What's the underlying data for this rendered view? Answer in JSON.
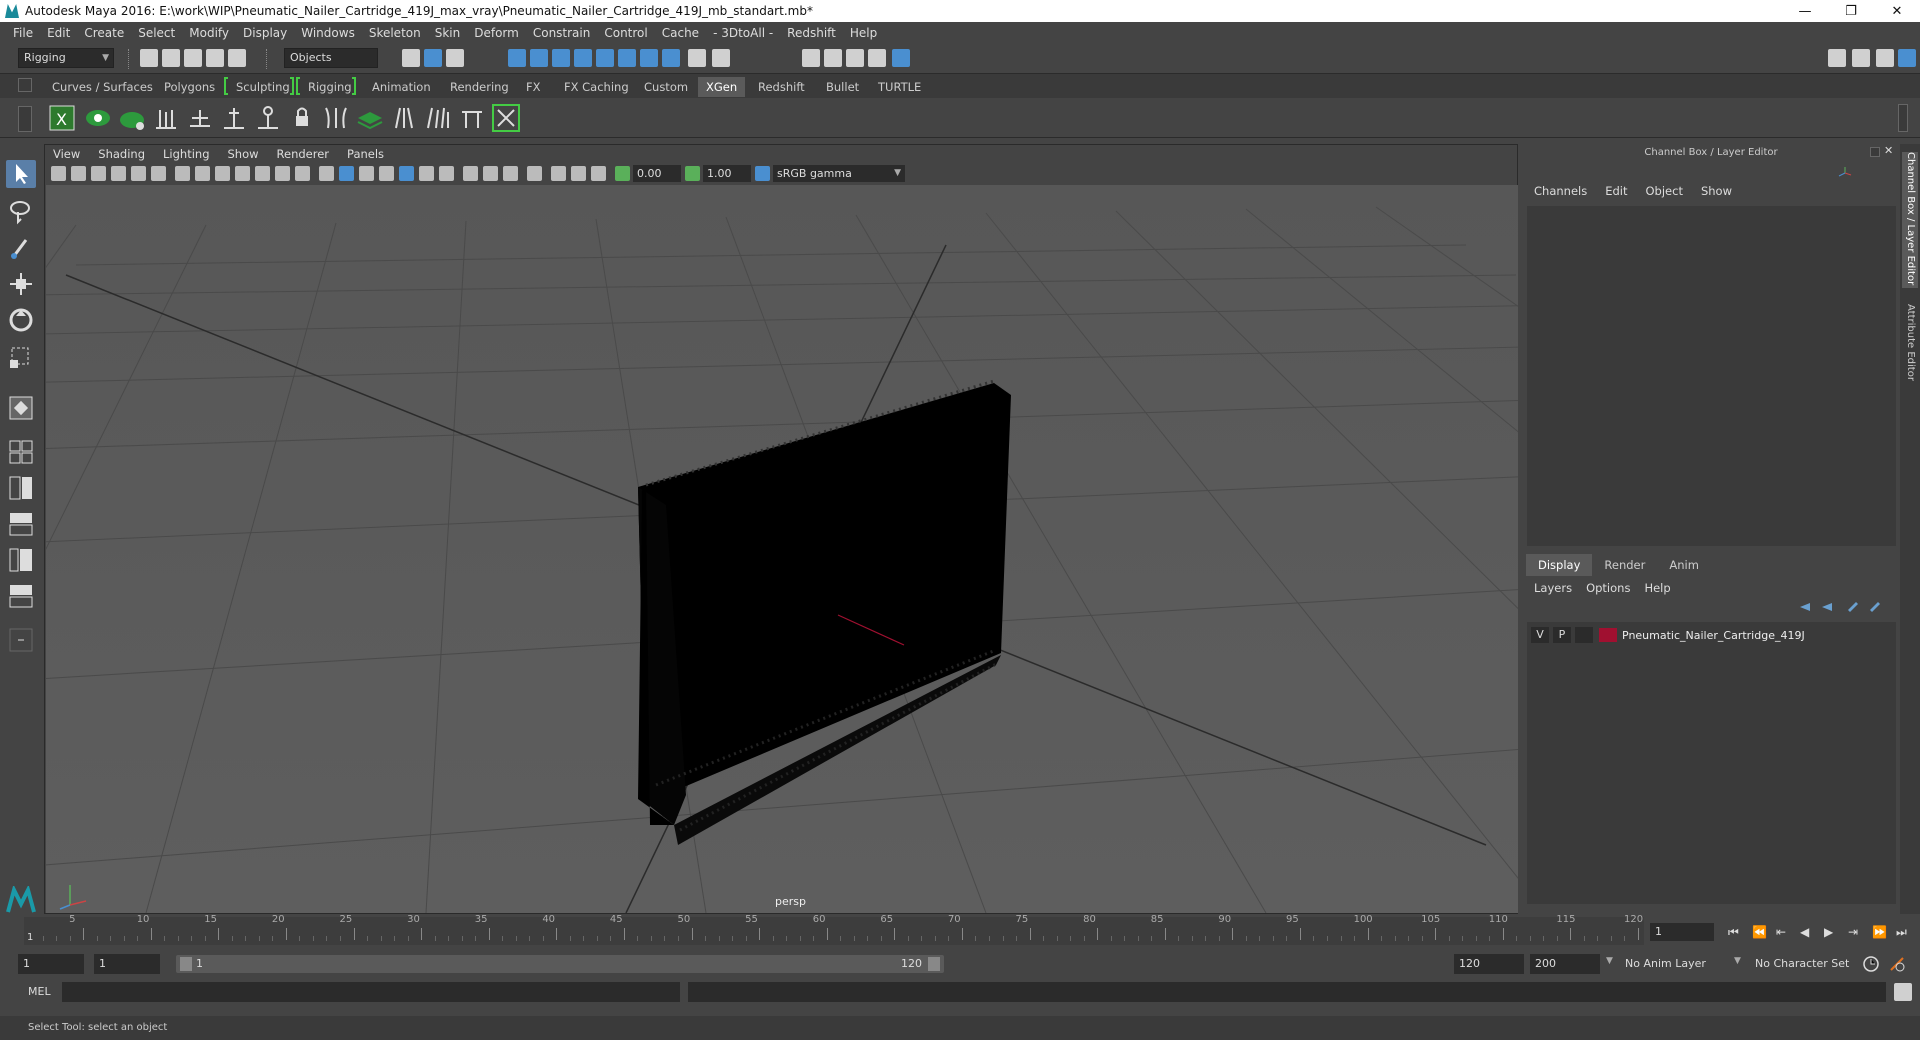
{
  "window": {
    "title": "Autodesk Maya 2016: E:\\work\\WIP\\Pneumatic_Nailer_Cartridge_419J_max_vray\\Pneumatic_Nailer_Cartridge_419J_mb_standart.mb*",
    "min": "—",
    "max": "❐",
    "close": "✕"
  },
  "menubar": [
    "File",
    "Edit",
    "Create",
    "Select",
    "Modify",
    "Display",
    "Windows",
    "Skeleton",
    "Skin",
    "Deform",
    "Constrain",
    "Control",
    "Cache",
    "- 3DtoAll -",
    "Redshift",
    "Help"
  ],
  "status": {
    "mode": "Rigging",
    "selection": "Objects"
  },
  "shelf_tabs": [
    "Curves / Surfaces",
    "Polygons",
    "Sculpting",
    "Rigging",
    "Animation",
    "Rendering",
    "FX",
    "FX Caching",
    "Custom",
    "XGen",
    "Redshift",
    "Bullet",
    "TURTLE"
  ],
  "shelf_active": "XGen",
  "viewport": {
    "menu": [
      "View",
      "Shading",
      "Lighting",
      "Show",
      "Renderer",
      "Panels"
    ],
    "exposure": "0.00",
    "gamma": "1.00",
    "colorspace": "sRGB gamma",
    "camera": "persp"
  },
  "channelbox": {
    "title": "Channel Box / Layer Editor",
    "menu": [
      "Channels",
      "Edit",
      "Object",
      "Show"
    ],
    "layer_tabs": [
      "Display",
      "Render",
      "Anim"
    ],
    "layer_menu": [
      "Layers",
      "Options",
      "Help"
    ],
    "layer": {
      "v": "V",
      "p": "P",
      "name": "Pneumatic_Nailer_Cartridge_419J",
      "color": "#a01030"
    }
  },
  "side_tabs": [
    "Channel Box / Layer Editor",
    "Attribute Editor"
  ],
  "timeline": {
    "ticks": [
      "5",
      "10",
      "15",
      "20",
      "25",
      "30",
      "35",
      "40",
      "45",
      "50",
      "55",
      "60",
      "65",
      "70",
      "75",
      "80",
      "85",
      "90",
      "95",
      "100",
      "105",
      "110",
      "115",
      "120"
    ],
    "start_label": "1",
    "current": "1"
  },
  "range": {
    "start": "1",
    "start2": "1",
    "slider_start": "1",
    "slider_end": "120",
    "end": "120",
    "end2": "200",
    "anim_layer": "No Anim Layer",
    "char_set": "No Character Set"
  },
  "cmd": {
    "label": "MEL"
  },
  "help": {
    "text": "Select Tool: select an object"
  }
}
